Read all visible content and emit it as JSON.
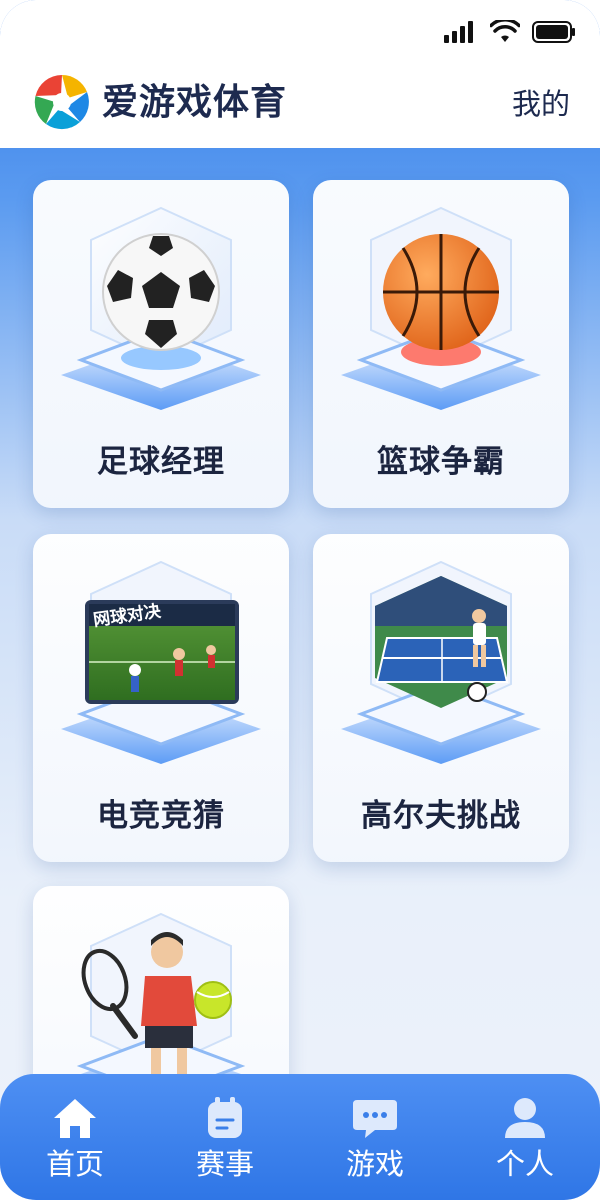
{
  "header": {
    "app_title": "爱游戏体育",
    "mine_label": "我的"
  },
  "games": [
    {
      "label": "足球经理",
      "icon": "soccer-ball-icon"
    },
    {
      "label": "篮球争霸",
      "icon": "basketball-icon"
    },
    {
      "label": "电竞竞猜",
      "icon": "esports-screen-icon",
      "screen_caption": "网球对决"
    },
    {
      "label": "高尔夫挑战",
      "icon": "tennis-court-icon"
    },
    {
      "label": "",
      "icon": "tennis-player-icon"
    }
  ],
  "bottom_nav": [
    {
      "label": "首页",
      "icon": "home-icon",
      "active": true
    },
    {
      "label": "赛事",
      "icon": "calendar-icon",
      "active": false
    },
    {
      "label": "游戏",
      "icon": "chat-bubble-icon",
      "active": false
    },
    {
      "label": "个人",
      "icon": "user-icon",
      "active": false
    }
  ],
  "colors": {
    "brand_blue": "#2f76e6",
    "title_text": "#1d2a4f",
    "card_bg": "#f6f9fe"
  }
}
